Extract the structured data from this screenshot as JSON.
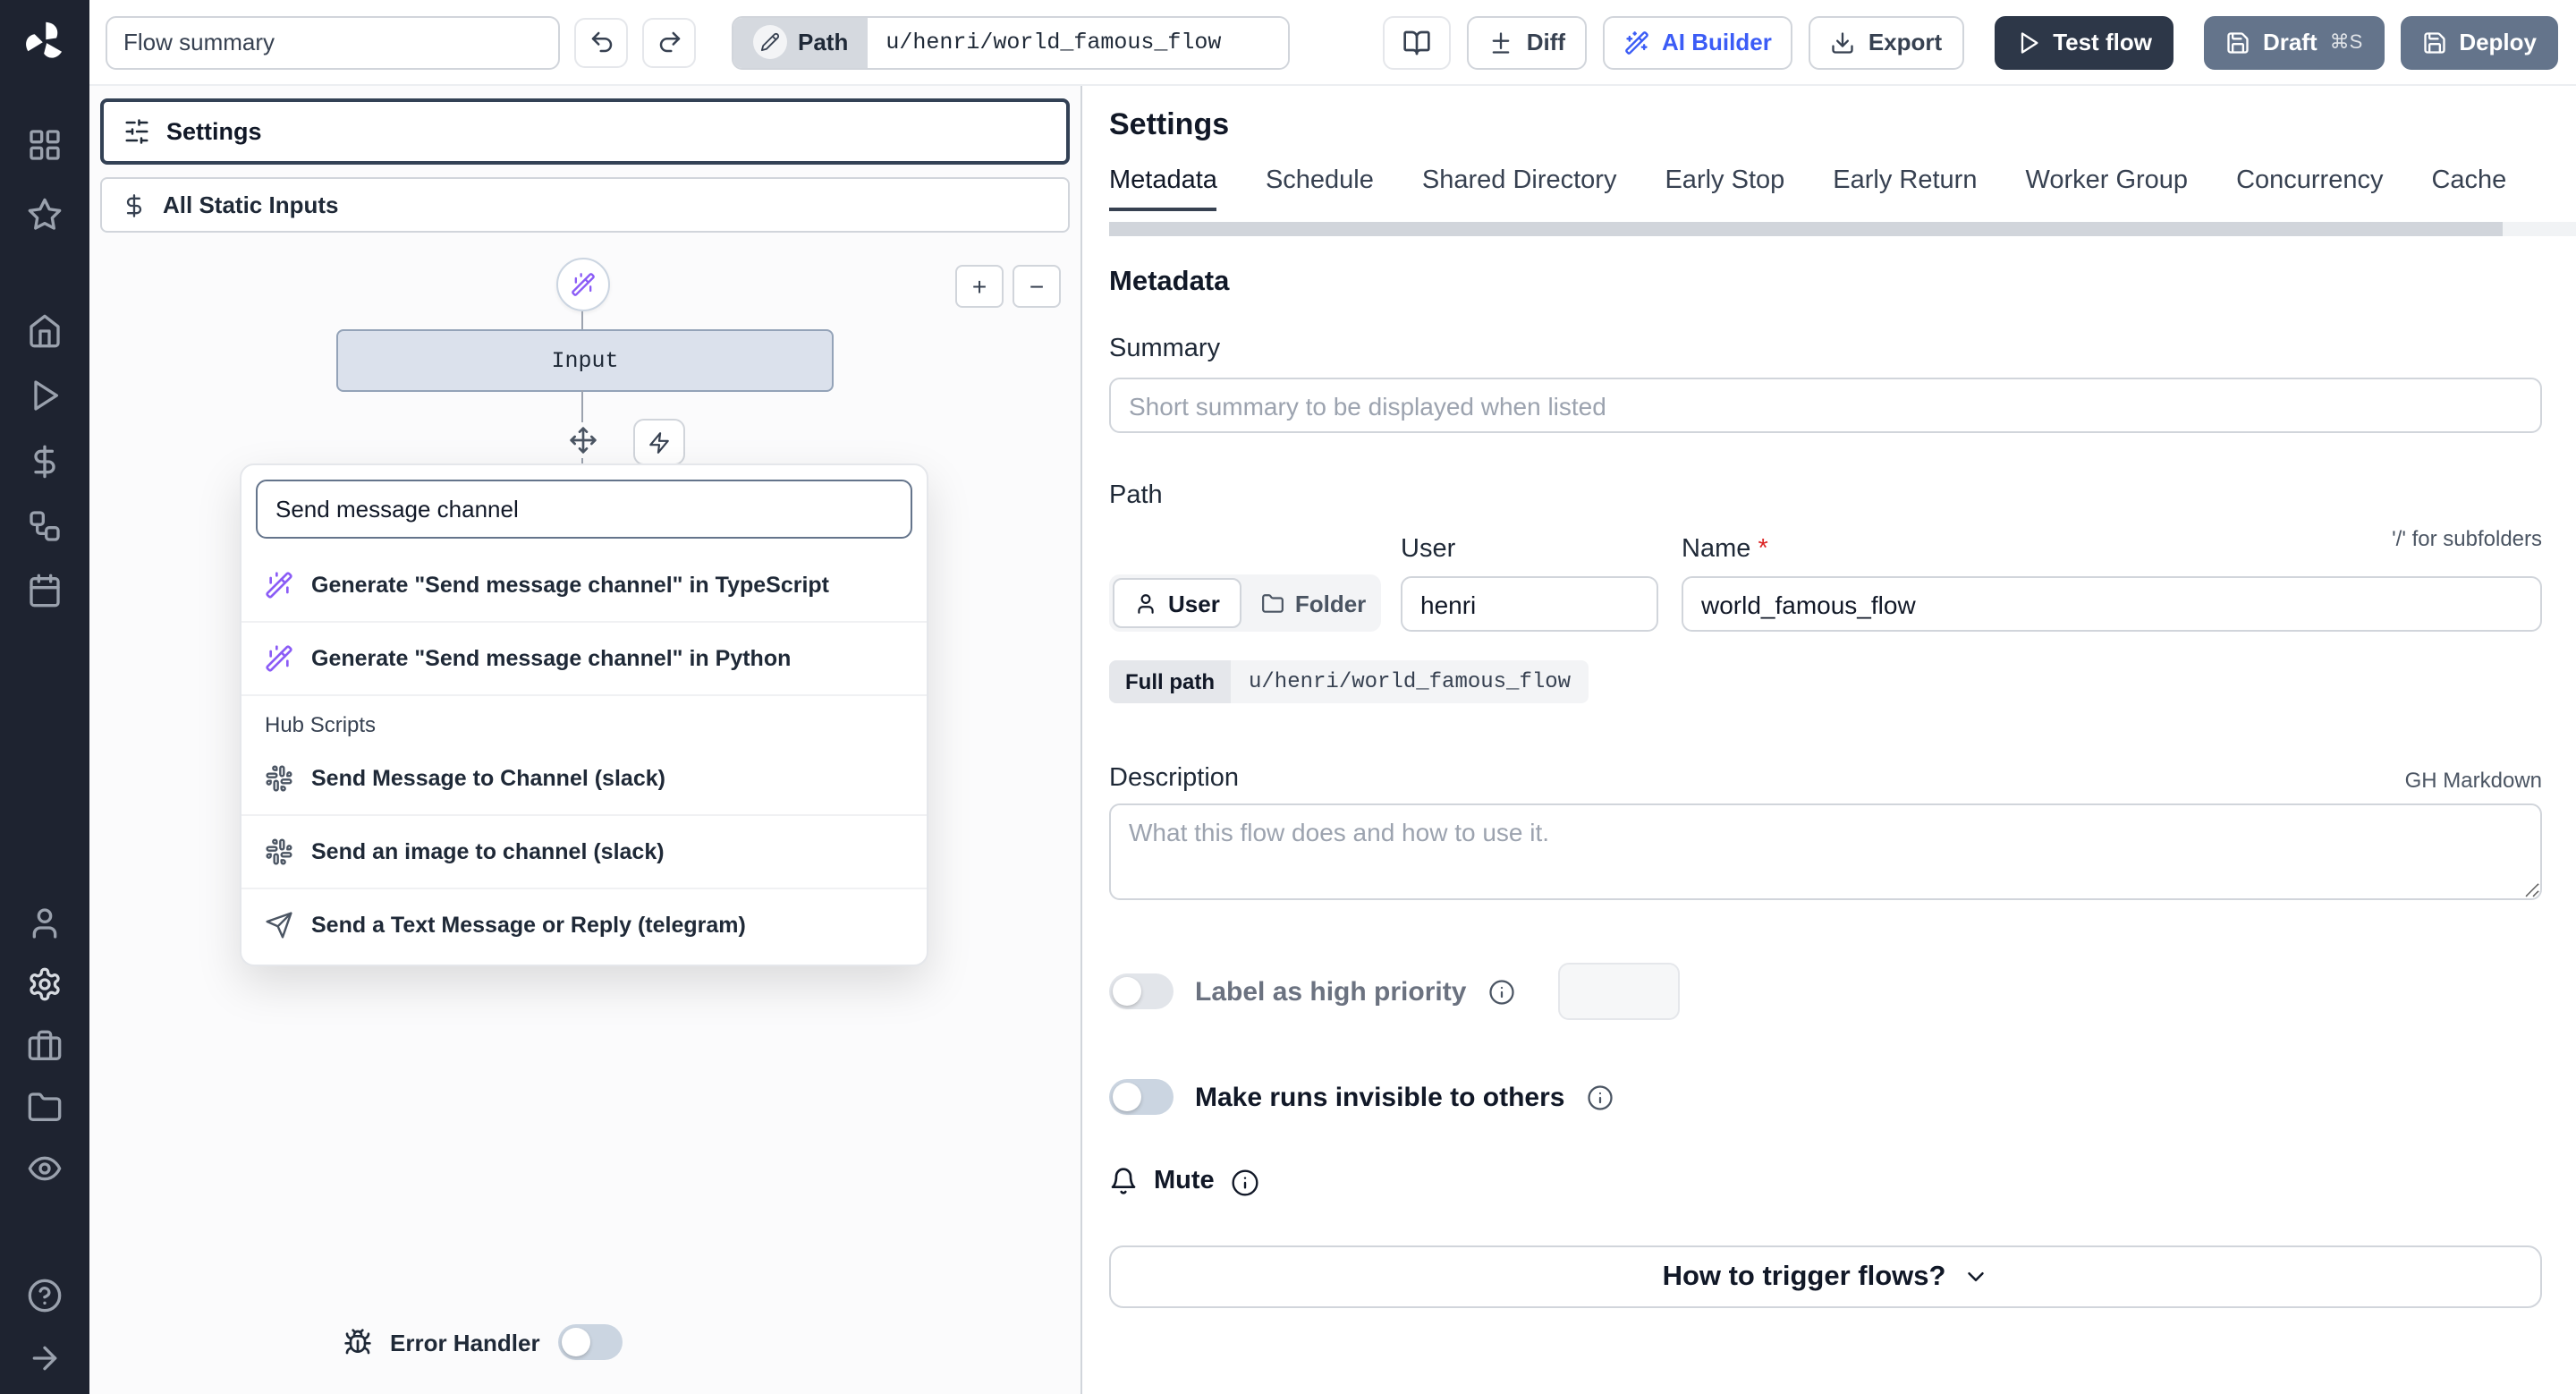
{
  "colors": {
    "sidebar_bg": "#1e2330",
    "accent_blue": "#3b5cf6",
    "wand_violet": "#8b5cf6",
    "test_flow_bg": "#2d3748",
    "deploy_bg": "#64748b",
    "required_red": "#dc2626",
    "input_node_bg": "#dbe1ec"
  },
  "sidebar": {
    "icons": [
      "windmill-logo",
      "grid",
      "star",
      "home",
      "play",
      "dollar",
      "workflow",
      "calendar",
      "user",
      "gear",
      "briefcase",
      "folder",
      "eye",
      "help",
      "arrow-right"
    ]
  },
  "topbar": {
    "flow_summary_value": "Flow summary",
    "undo_icon": "undo",
    "redo_icon": "redo",
    "path_label": "Path",
    "path_value": "u/henri/world_famous_flow",
    "book_icon": "book-open",
    "diff_label": "Diff",
    "ai_builder_label": "AI Builder",
    "export_label": "Export",
    "test_flow_label": "Test flow",
    "draft_label": "Draft",
    "draft_shortcut": "⌘S",
    "deploy_label": "Deploy"
  },
  "flow": {
    "settings_label": "Settings",
    "static_inputs_label": "All Static Inputs",
    "input_node_label": "Input",
    "zoom_in": "+",
    "zoom_out": "−",
    "search": {
      "value": "Send message channel",
      "generate_options": [
        {
          "label": "Generate \"Send message channel\" in TypeScript",
          "icon": "wand-icon"
        },
        {
          "label": "Generate \"Send message channel\" in Python",
          "icon": "wand-icon"
        }
      ],
      "hub_section_label": "Hub Scripts",
      "hub_items": [
        {
          "label": "Send Message to Channel (slack)",
          "icon": "slack-icon"
        },
        {
          "label": "Send an image to channel (slack)",
          "icon": "slack-icon"
        },
        {
          "label": "Send a Text Message or Reply (telegram)",
          "icon": "telegram-icon"
        }
      ]
    },
    "error_handler_label": "Error Handler"
  },
  "settings": {
    "title": "Settings",
    "tabs": [
      "Metadata",
      "Schedule",
      "Shared Directory",
      "Early Stop",
      "Early Return",
      "Worker Group",
      "Concurrency",
      "Cache"
    ],
    "active_tab": "Metadata",
    "metadata_heading": "Metadata",
    "summary_label": "Summary",
    "summary_placeholder": "Short summary to be displayed when listed",
    "path_label": "Path",
    "user_toggle_label": "User",
    "folder_toggle_label": "Folder",
    "user_field_label": "User",
    "user_value": "henri",
    "name_field_label": "Name",
    "name_required_mark": "*",
    "subfolder_hint": "'/' for subfolders",
    "name_value": "world_famous_flow",
    "full_path_label": "Full path",
    "full_path_value": "u/henri/world_famous_flow",
    "description_label": "Description",
    "description_hint": "GH Markdown",
    "description_placeholder": "What this flow does and how to use it.",
    "high_priority_label": "Label as high priority",
    "invisible_label": "Make runs invisible to others",
    "mute_label": "Mute",
    "trigger_button_label": "How to trigger flows?"
  }
}
